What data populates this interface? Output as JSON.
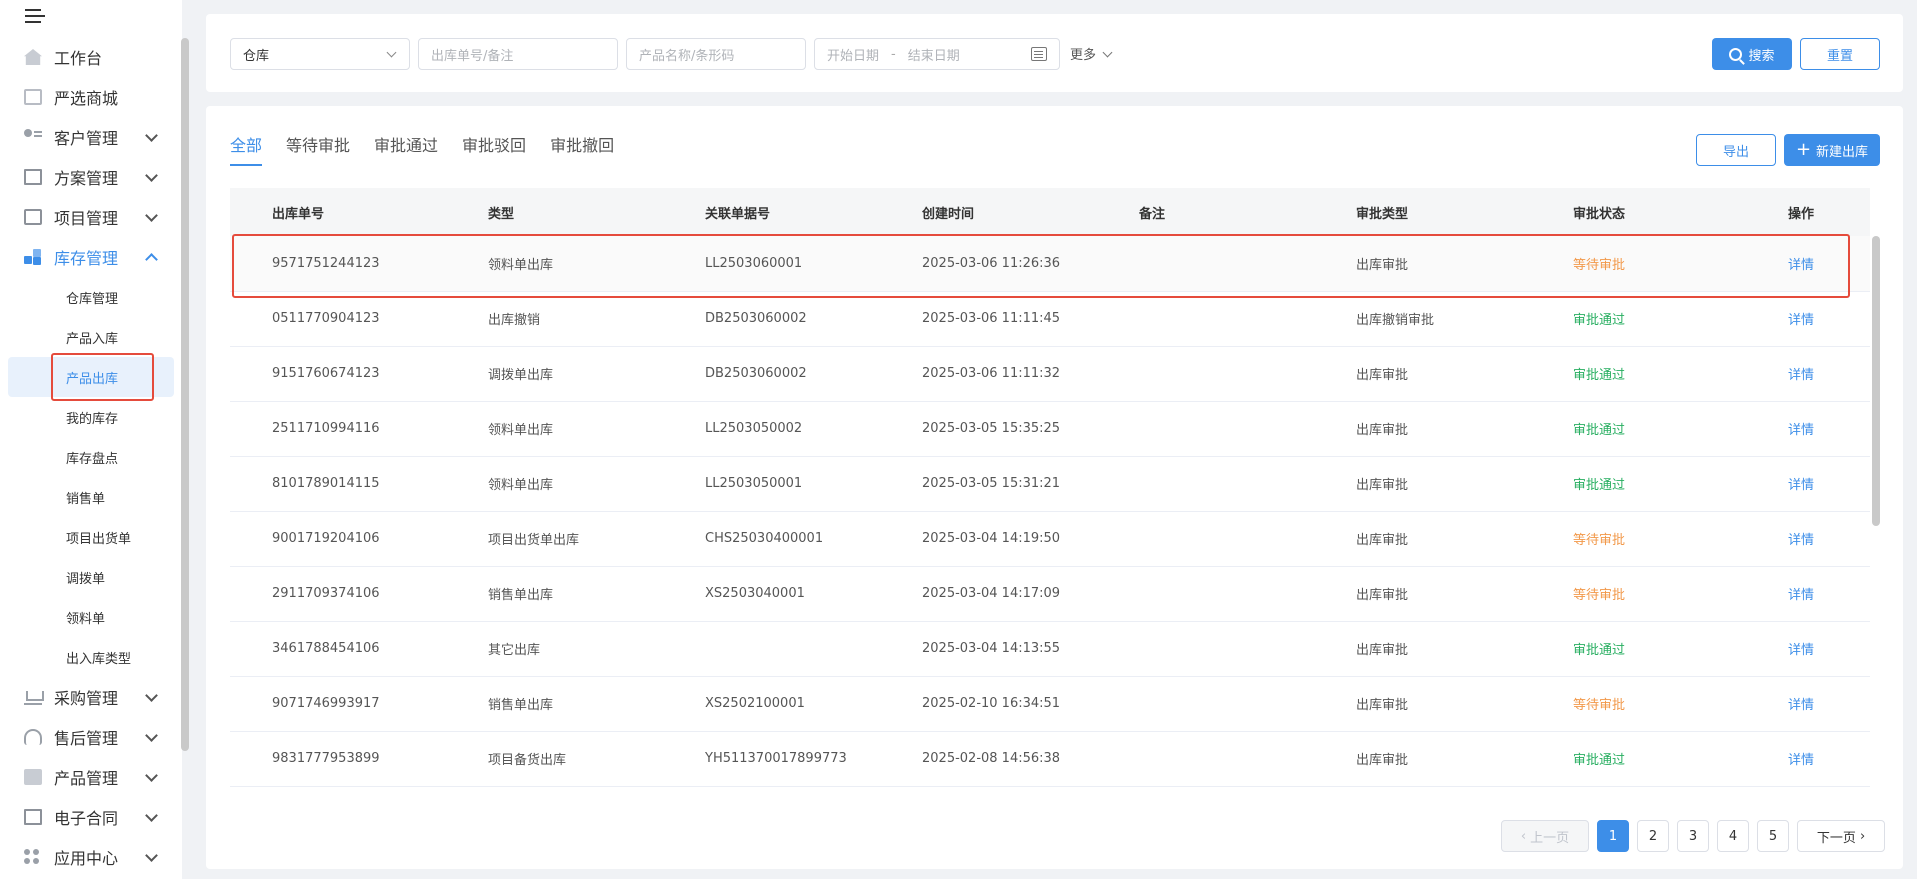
{
  "sidebar": {
    "menu": [
      {
        "label": "工作台",
        "icon": "home-icon"
      },
      {
        "label": "严选商城",
        "icon": "mall-icon"
      },
      {
        "label": "客户管理",
        "icon": "customer-icon"
      },
      {
        "label": "方案管理",
        "icon": "plan-icon"
      },
      {
        "label": "项目管理",
        "icon": "project-icon"
      },
      {
        "label": "库存管理",
        "icon": "inventory-icon"
      }
    ],
    "sub_items": [
      "仓库管理",
      "产品入库",
      "产品出库",
      "我的库存",
      "库存盘点",
      "销售单",
      "项目出货单",
      "调拨单",
      "领料单",
      "出入库类型"
    ],
    "menu_bottom": [
      {
        "label": "采购管理",
        "icon": "cart-icon"
      },
      {
        "label": "售后管理",
        "icon": "headset-icon"
      },
      {
        "label": "产品管理",
        "icon": "product-icon"
      },
      {
        "label": "电子合同",
        "icon": "contract-icon"
      },
      {
        "label": "应用中心",
        "icon": "apps-icon"
      }
    ]
  },
  "filters": {
    "warehouse": "仓库",
    "order_no_placeholder": "出库单号/备注",
    "product_placeholder": "产品名称/条形码",
    "start_date_placeholder": "开始日期",
    "date_separator": "-",
    "end_date_placeholder": "结束日期",
    "more": "更多",
    "search": "搜索",
    "reset": "重置"
  },
  "tabs": [
    "全部",
    "等待审批",
    "审批通过",
    "审批驳回",
    "审批撤回"
  ],
  "actions": {
    "export": "导出",
    "create": "新建出库"
  },
  "table": {
    "columns": [
      "出库单号",
      "类型",
      "关联单据号",
      "创建时间",
      "备注",
      "审批类型",
      "审批状态",
      "操作"
    ],
    "rows": [
      {
        "no": "9571751244123",
        "type": "领料单出库",
        "ref": "LL2503060001",
        "time": "2025-03-06 11:26:36",
        "note": "",
        "approval_type": "出库审批",
        "status": "等待审批",
        "op": "详情"
      },
      {
        "no": "0511770904123",
        "type": "出库撤销",
        "ref": "DB2503060002",
        "time": "2025-03-06 11:11:45",
        "note": "",
        "approval_type": "出库撤销审批",
        "status": "审批通过",
        "op": "详情"
      },
      {
        "no": "9151760674123",
        "type": "调拨单出库",
        "ref": "DB2503060002",
        "time": "2025-03-06 11:11:32",
        "note": "",
        "approval_type": "出库审批",
        "status": "审批通过",
        "op": "详情"
      },
      {
        "no": "2511710994116",
        "type": "领料单出库",
        "ref": "LL2503050002",
        "time": "2025-03-05 15:35:25",
        "note": "",
        "approval_type": "出库审批",
        "status": "审批通过",
        "op": "详情"
      },
      {
        "no": "8101789014115",
        "type": "领料单出库",
        "ref": "LL2503050001",
        "time": "2025-03-05 15:31:21",
        "note": "",
        "approval_type": "出库审批",
        "status": "审批通过",
        "op": "详情"
      },
      {
        "no": "9001719204106",
        "type": "项目出货单出库",
        "ref": "CHS25030400001",
        "time": "2025-03-04 14:19:50",
        "note": "",
        "approval_type": "出库审批",
        "status": "等待审批",
        "op": "详情"
      },
      {
        "no": "2911709374106",
        "type": "销售单出库",
        "ref": "XS2503040001",
        "time": "2025-03-04 14:17:09",
        "note": "",
        "approval_type": "出库审批",
        "status": "等待审批",
        "op": "详情"
      },
      {
        "no": "3461788454106",
        "type": "其它出库",
        "ref": "",
        "time": "2025-03-04 14:13:55",
        "note": "",
        "approval_type": "出库审批",
        "status": "审批通过",
        "op": "详情"
      },
      {
        "no": "9071746993917",
        "type": "销售单出库",
        "ref": "XS2502100001",
        "time": "2025-02-10 16:34:51",
        "note": "",
        "approval_type": "出库审批",
        "status": "等待审批",
        "op": "详情"
      },
      {
        "no": "9831777953899",
        "type": "项目备货出库",
        "ref": "YH511370017899773",
        "time": "2025-02-08 14:56:38",
        "note": "",
        "approval_type": "出库审批",
        "status": "审批通过",
        "op": "详情"
      }
    ]
  },
  "pagination": {
    "prev": "上一页",
    "pages": [
      "1",
      "2",
      "3",
      "4",
      "5"
    ],
    "next": "下一页"
  },
  "colors": {
    "accent": "#3d8ee8",
    "waiting": "#f2994a",
    "passed": "#27ae60",
    "highlight_border": "#e54b3c"
  }
}
